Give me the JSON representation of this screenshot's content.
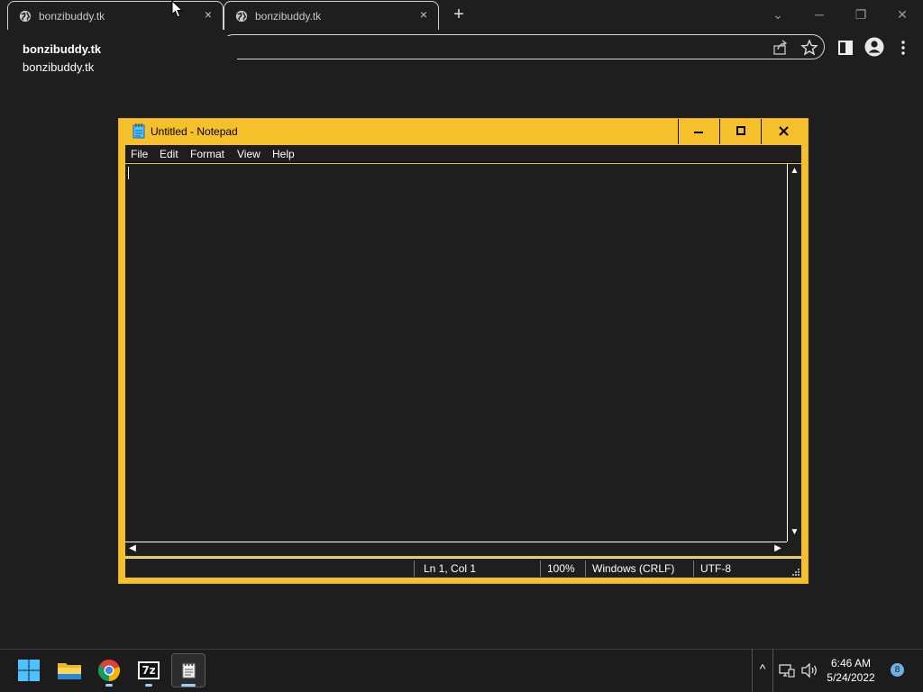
{
  "browser": {
    "tabs": [
      {
        "title": "bonzibuddy.tk",
        "close": "×"
      },
      {
        "title": "bonzibuddy.tk",
        "close": "×"
      }
    ],
    "new_tab": "+",
    "window_controls": {
      "dropdown": "⌄",
      "minimize": "─",
      "restore": "❐",
      "close": "✕"
    },
    "autocomplete": {
      "title": "bonzibuddy.tk",
      "url": "bonzibuddy.tk"
    },
    "icons": [
      "share-icon",
      "bookmark-star-icon",
      "side-panel-icon",
      "profile-icon",
      "menu-kebab-icon"
    ]
  },
  "notepad": {
    "title": "Untitled - Notepad",
    "controls": {
      "minimize": "─",
      "maximize": "□",
      "close": "✕"
    },
    "menu": [
      "File",
      "Edit",
      "Format",
      "View",
      "Help"
    ],
    "content": "",
    "status": {
      "position": "Ln 1, Col 1",
      "zoom": "100%",
      "line_endings": "Windows (CRLF)",
      "encoding": "UTF-8"
    },
    "accent_color": "#f5c02a"
  },
  "taskbar": {
    "apps": [
      "start-icon",
      "file-explorer-icon",
      "chrome-icon",
      "7zip-icon",
      "notepad-icon"
    ],
    "sevenzip_label": "7z",
    "overflow": "^",
    "time": "6:46 AM",
    "date": "5/24/2022",
    "notification_count": "8"
  }
}
